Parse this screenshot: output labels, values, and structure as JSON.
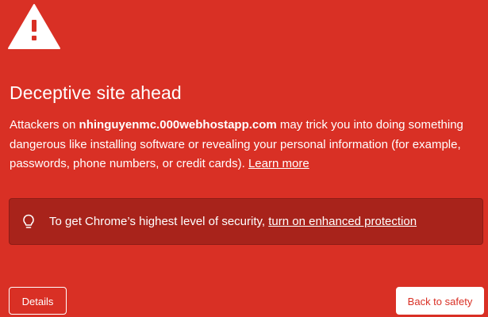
{
  "heading": {
    "title": "Deceptive site ahead"
  },
  "message": {
    "prefix": "Attackers on ",
    "domain": "nhinguyenmc.000webhostapp.com",
    "body": " may trick you into doing something dangerous like installing software or revealing your personal information (for example, passwords, phone numbers, or credit cards). ",
    "learn_more": "Learn more"
  },
  "enhanced_protection": {
    "text": "To get Chrome’s highest level of security, ",
    "link": "turn on enhanced protection",
    "icon": "lightbulb-icon"
  },
  "buttons": {
    "details": "Details",
    "back_to_safety": "Back to safety"
  },
  "icons": {
    "warning": "warning-triangle-icon"
  },
  "colors": {
    "background": "#d93025",
    "box_background": "#a8231b",
    "text": "#ffffff"
  }
}
